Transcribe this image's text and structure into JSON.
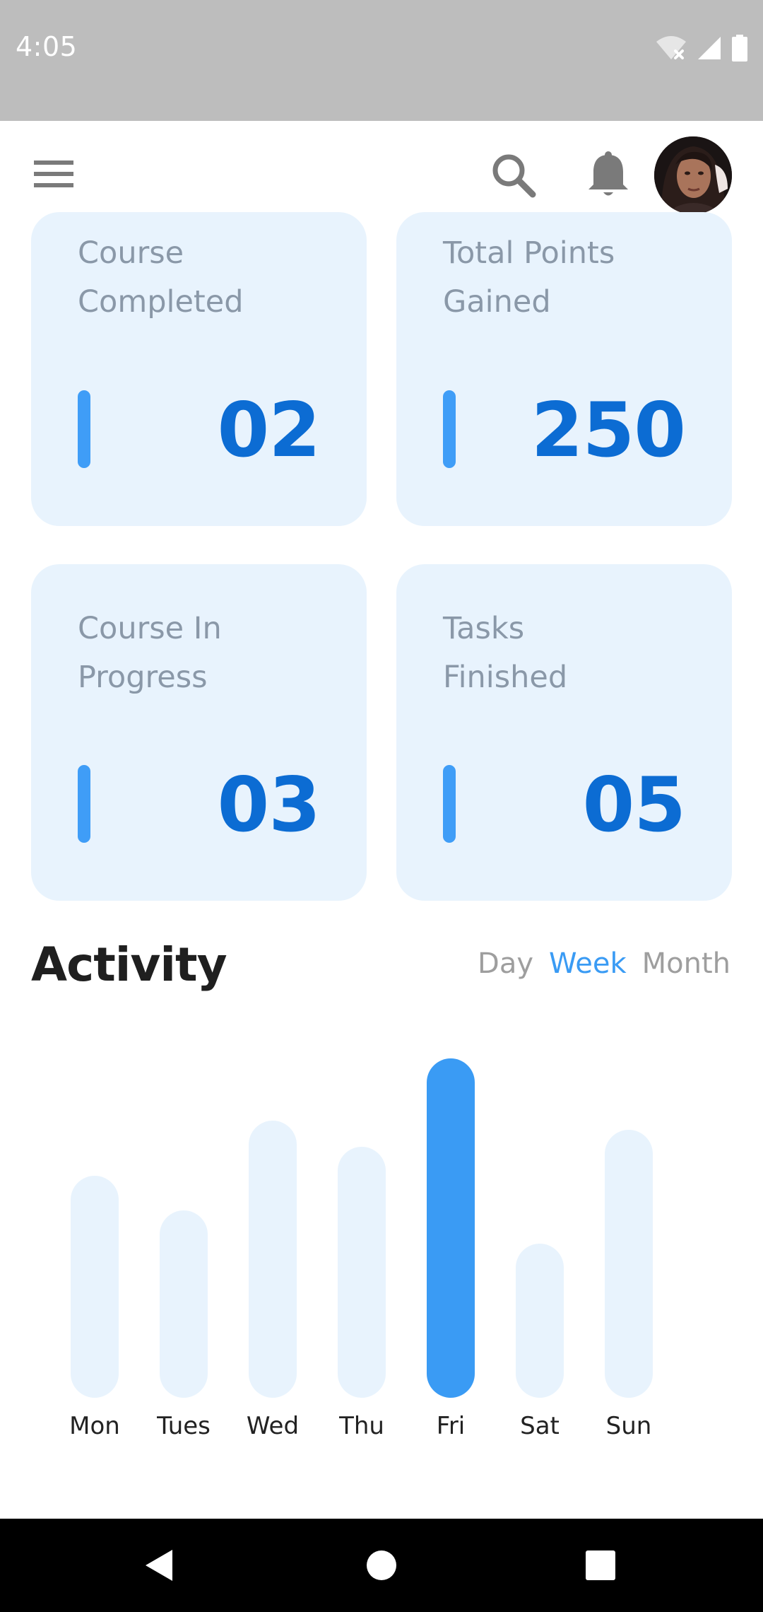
{
  "status_bar": {
    "time": "4:05",
    "icons": [
      "wifi-off-icon",
      "signal-icon",
      "battery-icon"
    ]
  },
  "app_bar": {
    "menu_icon": "menu-icon",
    "search_icon": "search-icon",
    "notification_icon": "bell-icon",
    "avatar": "user-avatar"
  },
  "stats": [
    {
      "title": "Course\nCompleted",
      "value": "02"
    },
    {
      "title": "Total Points\nGained",
      "value": "250"
    },
    {
      "title": "Course In\nProgress",
      "value": "03"
    },
    {
      "title": "Tasks\nFinished",
      "value": "05"
    }
  ],
  "activity": {
    "title": "Activity",
    "tabs": [
      "Day",
      "Week",
      "Month"
    ],
    "active_tab": "Week"
  },
  "chart_data": {
    "type": "bar",
    "categories": [
      "Mon",
      "Tues",
      "Wed",
      "Thu",
      "Fri",
      "Sat",
      "Sun"
    ],
    "values": [
      320,
      270,
      400,
      362,
      490,
      222,
      387
    ],
    "highlighted": "Fri",
    "ylim": [
      0,
      500
    ]
  },
  "colors": {
    "accent": "#3a9bf4",
    "card_bg": "#e8f3fd",
    "value_text": "#0c6cd3",
    "status_bar": "#bdbdbd"
  },
  "nav_bar": {
    "icons": [
      "back-icon",
      "home-icon",
      "recents-icon"
    ]
  }
}
